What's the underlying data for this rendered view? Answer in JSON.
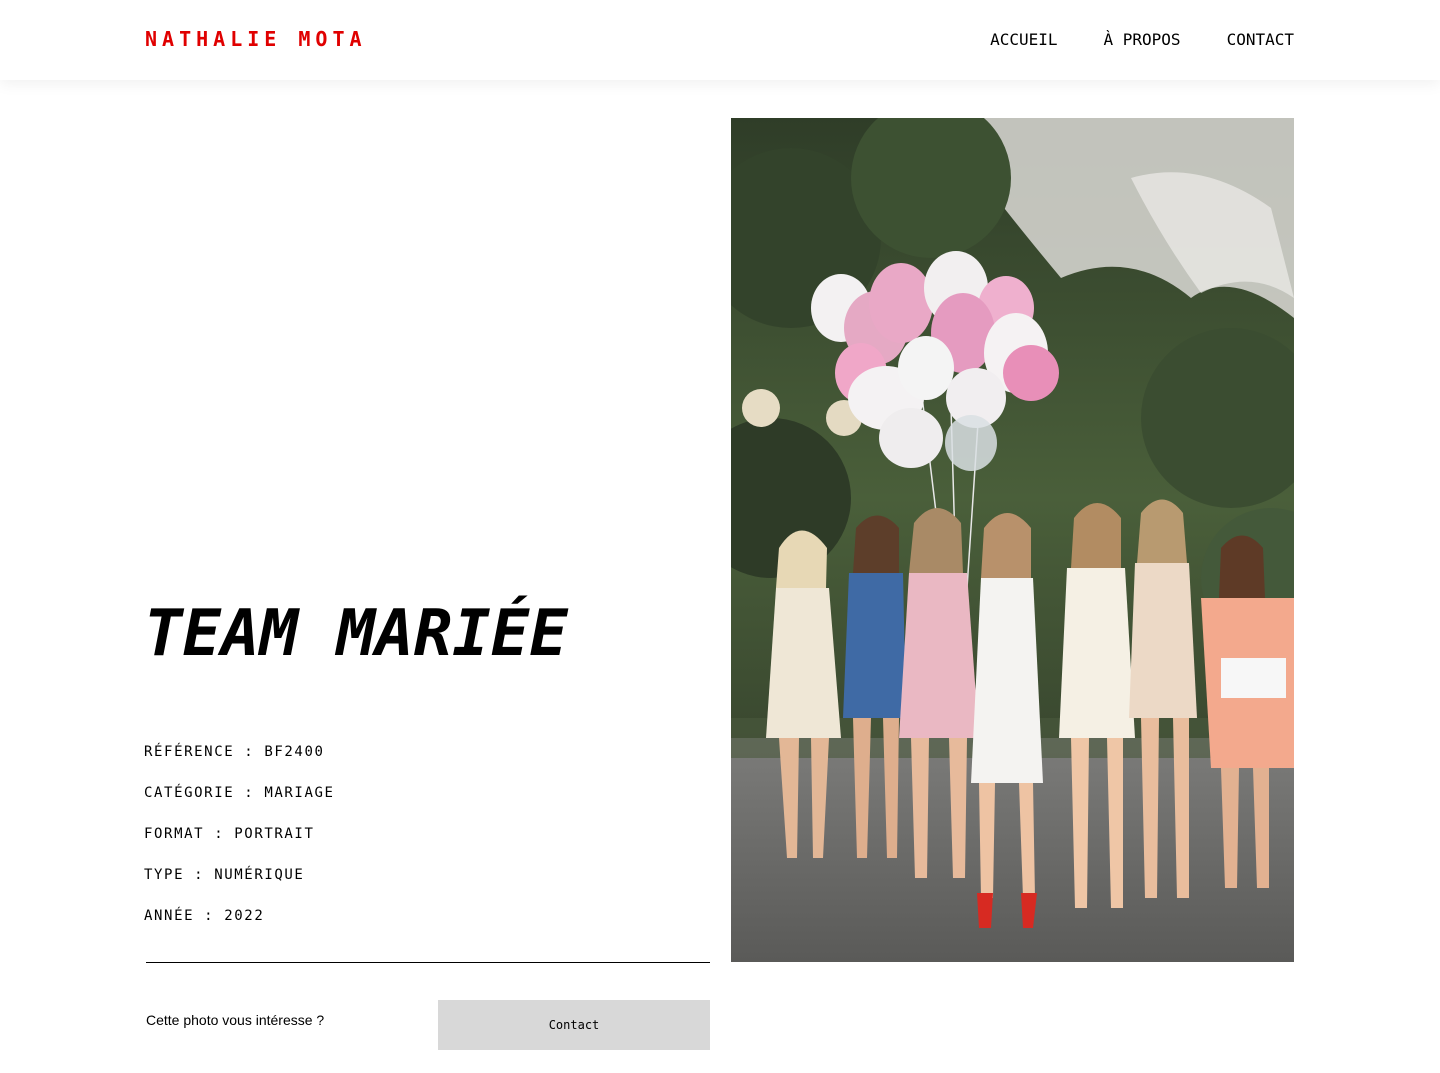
{
  "header": {
    "logo": "NATHALIE MOTA",
    "nav": [
      "ACCUEIL",
      "À PROPOS",
      "CONTACT"
    ]
  },
  "photo": {
    "title": "TEAM MARIÉE",
    "meta": [
      "RÉFÉRENCE : BF2400",
      "CATÉGORIE : MARIAGE",
      "FORMAT : PORTRAIT",
      "TYPE : NUMÉRIQUE",
      "ANNÉE : 2022"
    ],
    "image_icon": "photo-bridesmaids-balloons"
  },
  "cta": {
    "question": "Cette photo vous intéresse ?",
    "button": "Contact"
  },
  "colors": {
    "brand": "#E00000",
    "button_bg": "#D8D8D8",
    "text": "#000000"
  }
}
